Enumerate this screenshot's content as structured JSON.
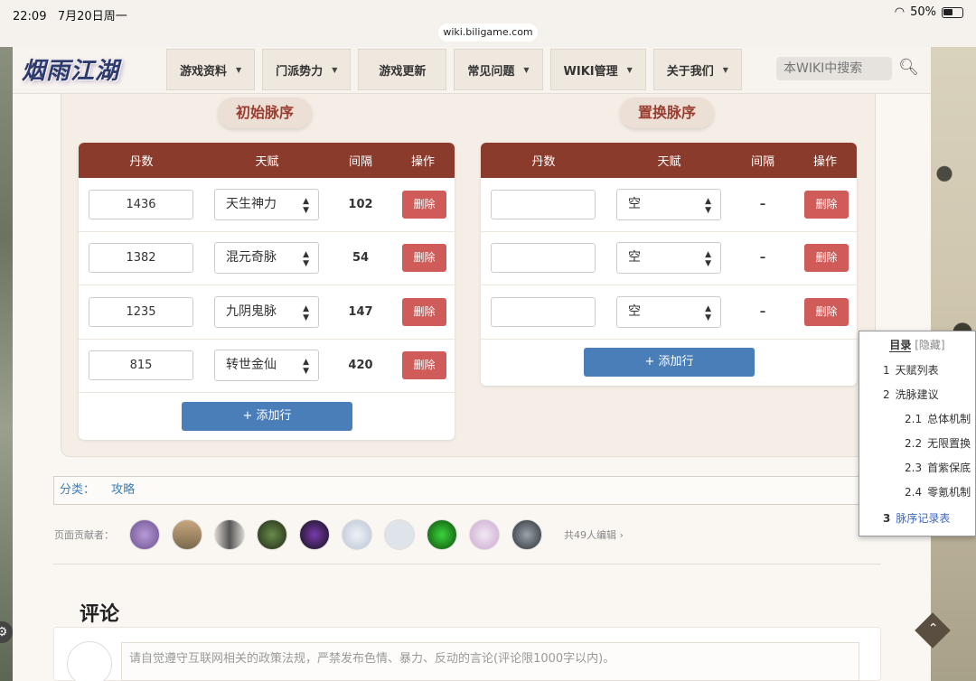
{
  "status": {
    "time": "22:09",
    "date": "7月20日周一",
    "battery": "50%",
    "url": "wiki.biligame.com"
  },
  "header": {
    "logo": "烟雨江湖",
    "nav": [
      {
        "label": "游戏资料"
      },
      {
        "label": "门派势力"
      },
      {
        "label": "游戏更新"
      },
      {
        "label": "常见问题"
      },
      {
        "label": "WIKI管理"
      },
      {
        "label": "关于我们"
      }
    ],
    "search_placeholder": "本WIKI中搜索"
  },
  "initial": {
    "title": "初始脉序",
    "columns": [
      "丹数",
      "天赋",
      "间隔",
      "操作"
    ],
    "rows": [
      {
        "dan": "1436",
        "talent": "天生神力",
        "interval": "102",
        "action": "删除"
      },
      {
        "dan": "1382",
        "talent": "混元奇脉",
        "interval": "54",
        "action": "删除"
      },
      {
        "dan": "1235",
        "talent": "九阴鬼脉",
        "interval": "147",
        "action": "删除"
      },
      {
        "dan": "815",
        "talent": "转世金仙",
        "interval": "420",
        "action": "删除"
      }
    ],
    "add_label": "+ 添加行"
  },
  "replace": {
    "title": "置换脉序",
    "columns": [
      "丹数",
      "天赋",
      "间隔",
      "操作"
    ],
    "rows": [
      {
        "dan": "",
        "talent": "空",
        "interval": "–",
        "action": "删除"
      },
      {
        "dan": "",
        "talent": "空",
        "interval": "–",
        "action": "删除"
      },
      {
        "dan": "",
        "talent": "空",
        "interval": "–",
        "action": "删除"
      }
    ],
    "add_label": "+ 添加行"
  },
  "category": {
    "label": "分类：",
    "link": "攻略"
  },
  "contributors": {
    "label": "页面贡献者：",
    "count": "共49人编辑"
  },
  "comments": {
    "title": "评论",
    "placeholder": "请自觉遵守互联网相关的政策法规，严禁发布色情、暴力、反动的言论(评论限1000字以内)。"
  },
  "toc": {
    "title": "目录",
    "hide": "[隐藏]",
    "items": [
      {
        "num": "1",
        "label": "天赋列表"
      },
      {
        "num": "2",
        "label": "洗脉建议"
      },
      {
        "num": "2.1",
        "label": "总体机制"
      },
      {
        "num": "2.2",
        "label": "无限置换"
      },
      {
        "num": "2.3",
        "label": "首紫保底"
      },
      {
        "num": "2.4",
        "label": "零氪机制"
      },
      {
        "num": "3",
        "label": "脉序记录表"
      }
    ]
  },
  "colors": {
    "header_red": "#8b3b2c",
    "delete_red": "#cf5c59",
    "add_blue": "#4a7eb8",
    "link_blue": "#3b7fb8"
  }
}
